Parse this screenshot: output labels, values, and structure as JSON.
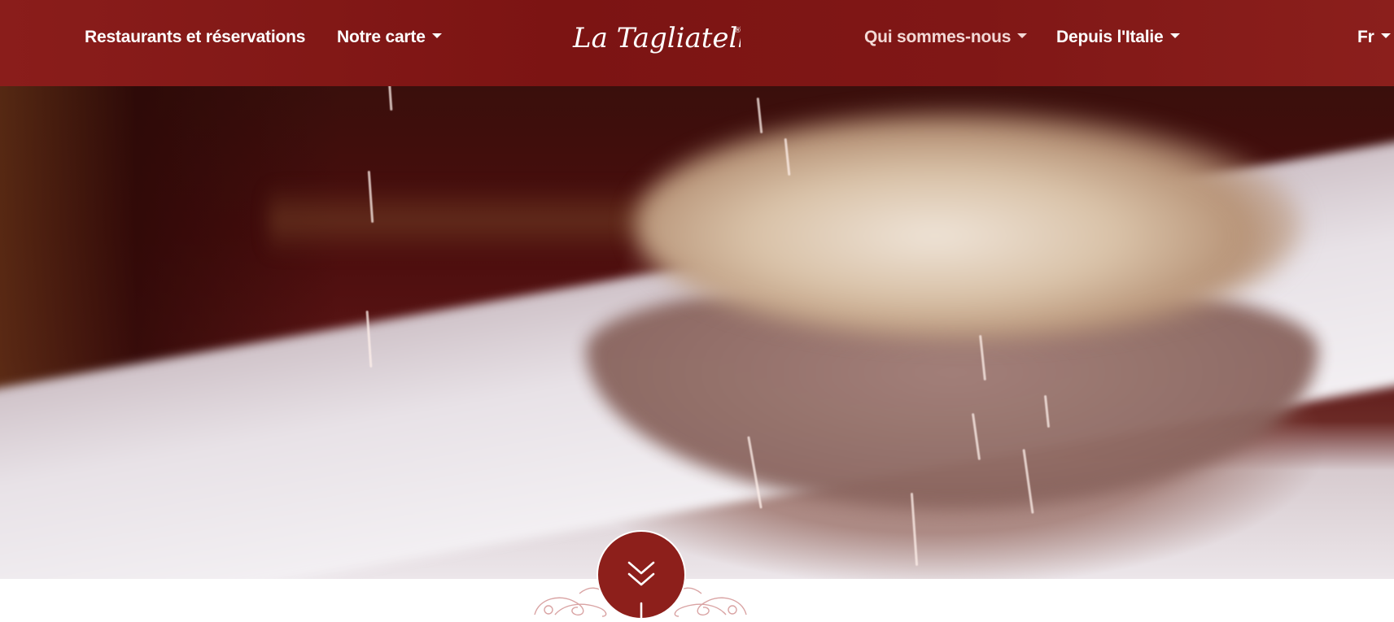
{
  "brand": {
    "name": "La Tagliatella",
    "registered_mark": "®"
  },
  "nav": {
    "left": [
      {
        "label": "Restaurants et réservations",
        "has_dropdown": false
      },
      {
        "label": "Notre carte",
        "has_dropdown": true
      }
    ],
    "right": [
      {
        "label": "Qui sommes-nous",
        "has_dropdown": true
      },
      {
        "label": "Depuis l'Italie",
        "has_dropdown": true
      }
    ],
    "language": {
      "label": "Fr",
      "has_dropdown": true
    }
  },
  "hero": {
    "icon": "scroll-down-chevrons-icon"
  },
  "colors": {
    "header_bg": "#7c1413",
    "accent": "#8d1f1b",
    "nav_text": "#ffffff",
    "nav_text_active": "#f3d9d6"
  }
}
